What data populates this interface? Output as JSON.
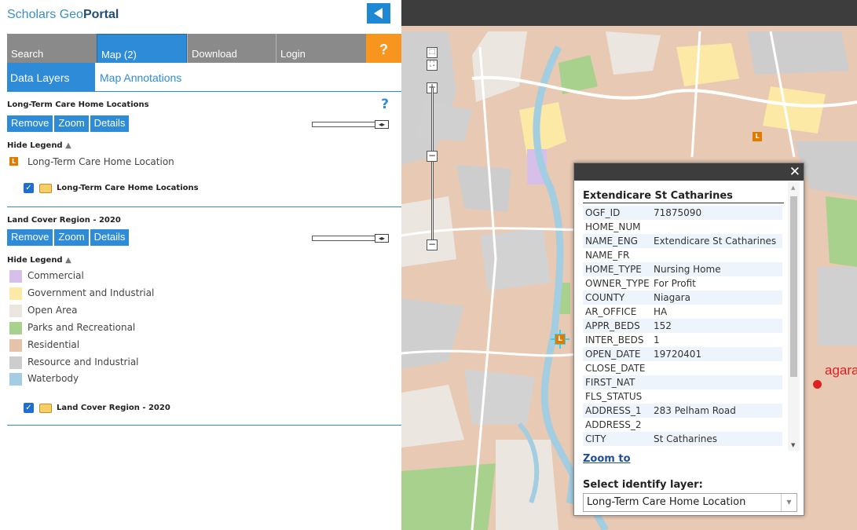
{
  "app": {
    "logo_text": "Scholars Geo",
    "logo_bold": "Portal"
  },
  "tabs": [
    {
      "label": "Search"
    },
    {
      "label": "Map (2)"
    },
    {
      "label": "Download"
    },
    {
      "label": "Login"
    },
    {
      "label": "?"
    }
  ],
  "subtabs": {
    "data_layers": "Data Layers",
    "map_annotations": "Map Annotations"
  },
  "layers": [
    {
      "title": "Long-Term Care Home Locations",
      "help": "?",
      "buttons": [
        "Remove",
        "Zoom",
        "Details"
      ],
      "hide_legend": "Hide Legend",
      "legend": [
        {
          "label": "Long-Term Care Home Location",
          "color": "#e07b00",
          "icon": "L"
        }
      ],
      "checkbox_label": "Long-Term Care Home Locations"
    },
    {
      "title": "Land Cover Region - 2020",
      "buttons": [
        "Remove",
        "Zoom",
        "Details"
      ],
      "hide_legend": "Hide Legend",
      "legend": [
        {
          "label": "Commercial",
          "color": "#d6bfe8"
        },
        {
          "label": "Government and Industrial",
          "color": "#fde9a6"
        },
        {
          "label": "Open Area",
          "color": "#ece6e0"
        },
        {
          "label": "Parks and Recreational",
          "color": "#a9d18e"
        },
        {
          "label": "Residential",
          "color": "#e6c2a8"
        },
        {
          "label": "Resource and Industrial",
          "color": "#cdcdcd"
        },
        {
          "label": "Waterbody",
          "color": "#a3cde0"
        }
      ],
      "checkbox_label": "Land Cover Region - 2020"
    }
  ],
  "popup": {
    "title": "Extendicare St Catharines",
    "close": "✕",
    "rows": [
      {
        "key": "OGF_ID",
        "value": "71875090"
      },
      {
        "key": "HOME_NUM",
        "value": ""
      },
      {
        "key": "NAME_ENG",
        "value": "Extendicare St Catharines"
      },
      {
        "key": "NAME_FR",
        "value": ""
      },
      {
        "key": "HOME_TYPE",
        "value": "Nursing Home"
      },
      {
        "key": "OWNER_TYPE",
        "value": "For Profit"
      },
      {
        "key": "COUNTY",
        "value": "Niagara"
      },
      {
        "key": "AR_OFFICE",
        "value": "HA"
      },
      {
        "key": "APPR_BEDS",
        "value": "152"
      },
      {
        "key": "INTER_BEDS",
        "value": "1"
      },
      {
        "key": "OPEN_DATE",
        "value": "19720401"
      },
      {
        "key": "CLOSE_DATE",
        "value": ""
      },
      {
        "key": "FIRST_NAT",
        "value": ""
      },
      {
        "key": "FLS_STATUS",
        "value": ""
      },
      {
        "key": "ADDRESS_1",
        "value": "283 Pelham Road"
      },
      {
        "key": "ADDRESS_2",
        "value": ""
      },
      {
        "key": "CITY",
        "value": "St Catharines"
      }
    ],
    "zoom_to": "Zoom to",
    "select_label": "Select identify layer:",
    "select_value": "Long-Term Care Home Location"
  },
  "map": {
    "place_label": "agara",
    "marker_icon": "L"
  },
  "colors": {
    "accent": "#2e8bd8",
    "help_orange": "#f7951e",
    "marker": "#e07b00",
    "highlight": "#2fd1f5"
  }
}
